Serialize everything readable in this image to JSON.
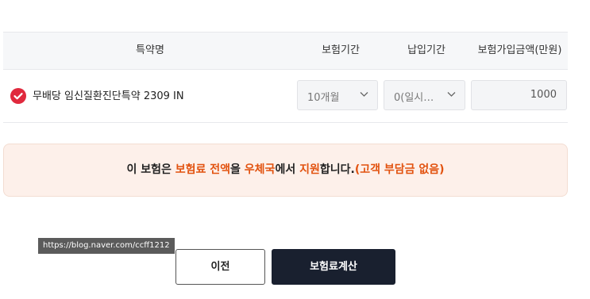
{
  "table": {
    "headers": {
      "name": "특약명",
      "period": "보험기간",
      "payment": "납입기간",
      "amount": "보험가입금액(만원)"
    },
    "rows": [
      {
        "checked": true,
        "name": "무배당 임신질환진단특약 2309 IN",
        "period": "10개월",
        "payment": "0(일시…",
        "amount": "1000"
      }
    ]
  },
  "notice": {
    "p1": "이 보험은 ",
    "p2": "보험료 전액",
    "p3": "을 ",
    "p4": "우체국",
    "p5": "에서 ",
    "p6": "지원",
    "p7": "합니다.",
    "p8": "(고객 부담금 없음)"
  },
  "tooltip": {
    "url": "https://blog.naver.com/ccff1212"
  },
  "buttons": {
    "prev": "이전",
    "calculate": "보험료계산"
  },
  "colors": {
    "check": "#e0293d",
    "highlight": "#e2520f",
    "notice_bg": "#fdf0ea",
    "primary_button": "#19202f"
  }
}
